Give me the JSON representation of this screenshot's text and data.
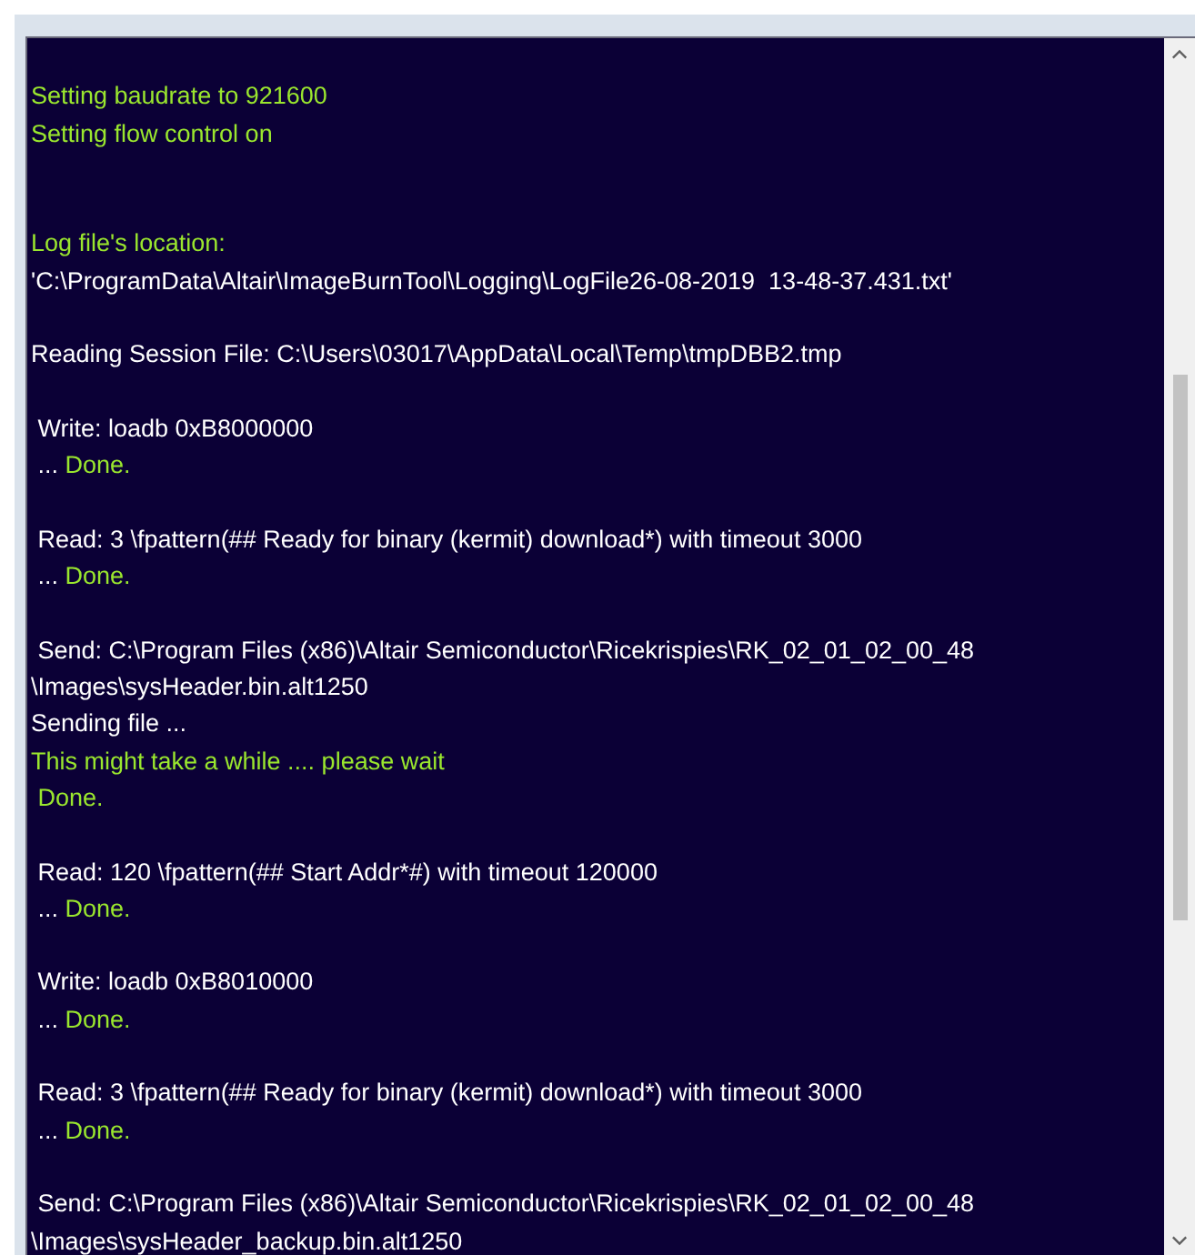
{
  "log": {
    "lines": [
      {
        "kind": "blank"
      },
      {
        "kind": "text",
        "segments": [
          {
            "text": "Setting baudrate to 921600",
            "kind": "status"
          }
        ]
      },
      {
        "kind": "text",
        "segments": [
          {
            "text": "Setting flow control on",
            "kind": "status"
          }
        ]
      },
      {
        "kind": "blank"
      },
      {
        "kind": "blank"
      },
      {
        "kind": "text",
        "segments": [
          {
            "text": "Log file's location:",
            "kind": "status"
          }
        ]
      },
      {
        "kind": "text",
        "segments": [
          {
            "text": "'C:\\ProgramData\\Altair\\ImageBurnTool\\Logging\\LogFile26-08-2019  13-48-37.431.txt'",
            "kind": "info"
          }
        ]
      },
      {
        "kind": "blank"
      },
      {
        "kind": "text",
        "segments": [
          {
            "text": "Reading Session File: C:\\Users\\03017\\AppData\\Local\\Temp\\tmpDBB2.tmp",
            "kind": "info"
          }
        ]
      },
      {
        "kind": "blank"
      },
      {
        "kind": "text",
        "segments": [
          {
            "text": " Write: loadb 0xB8000000",
            "kind": "info"
          }
        ]
      },
      {
        "kind": "text",
        "segments": [
          {
            "text": " ... ",
            "kind": "info"
          },
          {
            "text": "Done.",
            "kind": "status"
          }
        ]
      },
      {
        "kind": "blank"
      },
      {
        "kind": "text",
        "segments": [
          {
            "text": " Read: 3 \\fpattern(## Ready for binary (kermit) download*) with timeout 3000",
            "kind": "info"
          }
        ]
      },
      {
        "kind": "text",
        "segments": [
          {
            "text": " ... ",
            "kind": "info"
          },
          {
            "text": "Done.",
            "kind": "status"
          }
        ]
      },
      {
        "kind": "blank"
      },
      {
        "kind": "text",
        "segments": [
          {
            "text": " Send: C:\\Program Files (x86)\\Altair Semiconductor\\Ricekrispies\\RK_02_01_02_00_48",
            "kind": "info"
          }
        ]
      },
      {
        "kind": "text",
        "segments": [
          {
            "text": "\\Images\\sysHeader.bin.alt1250",
            "kind": "info"
          }
        ]
      },
      {
        "kind": "text",
        "segments": [
          {
            "text": "Sending file ...",
            "kind": "info"
          }
        ]
      },
      {
        "kind": "text",
        "segments": [
          {
            "text": "This might take a while .... please wait",
            "kind": "status"
          }
        ]
      },
      {
        "kind": "text",
        "segments": [
          {
            "text": " Done.",
            "kind": "status"
          }
        ]
      },
      {
        "kind": "blank"
      },
      {
        "kind": "text",
        "segments": [
          {
            "text": " Read: 120 \\fpattern(## Start Addr*#) with timeout 120000",
            "kind": "info"
          }
        ]
      },
      {
        "kind": "text",
        "segments": [
          {
            "text": " ... ",
            "kind": "info"
          },
          {
            "text": "Done.",
            "kind": "status"
          }
        ]
      },
      {
        "kind": "blank"
      },
      {
        "kind": "text",
        "segments": [
          {
            "text": " Write: loadb 0xB8010000",
            "kind": "info"
          }
        ]
      },
      {
        "kind": "text",
        "segments": [
          {
            "text": " ... ",
            "kind": "info"
          },
          {
            "text": "Done.",
            "kind": "status"
          }
        ]
      },
      {
        "kind": "blank"
      },
      {
        "kind": "text",
        "segments": [
          {
            "text": " Read: 3 \\fpattern(## Ready for binary (kermit) download*) with timeout 3000",
            "kind": "info"
          }
        ]
      },
      {
        "kind": "text",
        "segments": [
          {
            "text": " ... ",
            "kind": "info"
          },
          {
            "text": "Done.",
            "kind": "status"
          }
        ]
      },
      {
        "kind": "blank"
      },
      {
        "kind": "text",
        "segments": [
          {
            "text": " Send: C:\\Program Files (x86)\\Altair Semiconductor\\Ricekrispies\\RK_02_01_02_00_48",
            "kind": "info"
          }
        ]
      },
      {
        "kind": "text",
        "segments": [
          {
            "text": "\\Images\\sysHeader_backup.bin.alt1250",
            "kind": "info"
          }
        ]
      }
    ]
  }
}
